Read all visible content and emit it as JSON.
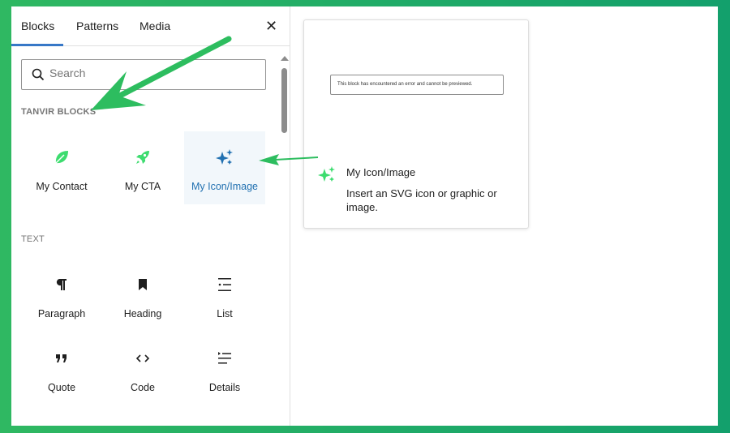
{
  "tabs": [
    {
      "label": "Blocks"
    },
    {
      "label": "Patterns"
    },
    {
      "label": "Media"
    }
  ],
  "close_label": "✕",
  "search": {
    "placeholder": "Search"
  },
  "categories": [
    {
      "title": "TANVIR BLOCKS",
      "items": [
        {
          "label": "My Contact",
          "icon": "leaf-icon"
        },
        {
          "label": "My CTA",
          "icon": "rocket-icon"
        },
        {
          "label": "My Icon/Image",
          "icon": "sparkles-icon",
          "selected": true
        }
      ]
    },
    {
      "title": "TEXT",
      "items": [
        {
          "label": "Paragraph",
          "icon": "paragraph-icon"
        },
        {
          "label": "Heading",
          "icon": "bookmark-icon"
        },
        {
          "label": "List",
          "icon": "list-icon"
        },
        {
          "label": "Quote",
          "icon": "quote-icon"
        },
        {
          "label": "Code",
          "icon": "code-icon"
        },
        {
          "label": "Details",
          "icon": "details-icon"
        }
      ]
    }
  ],
  "preview": {
    "error_text": "This block has encountered an error and cannot be previewed.",
    "title": "My Icon/Image",
    "description": "Insert an SVG icon or graphic or image."
  },
  "colors": {
    "accent": "#2271b1",
    "annotation": "#2dbd5f",
    "icon_green": "#3ddc6f"
  }
}
